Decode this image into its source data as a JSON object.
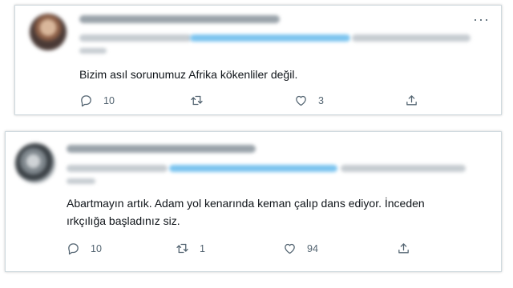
{
  "tweets": [
    {
      "text": "Bizim asıl sorunumuz Afrika kökenliler değil.",
      "reply_count": "10",
      "retweet_count": "",
      "like_count": "3"
    },
    {
      "text_line1": "Abartmayın artık. Adam yol kenarında keman çalıp dans ediyor. İnceden",
      "text_line2": "ırkçılığa başladınız siz.",
      "reply_count": "10",
      "retweet_count": "1",
      "like_count": "94"
    }
  ],
  "icons": {
    "reply": "speech-bubble",
    "retweet": "retweet-arrows",
    "like": "heart",
    "share": "upload-arrow",
    "more": "ellipsis"
  }
}
